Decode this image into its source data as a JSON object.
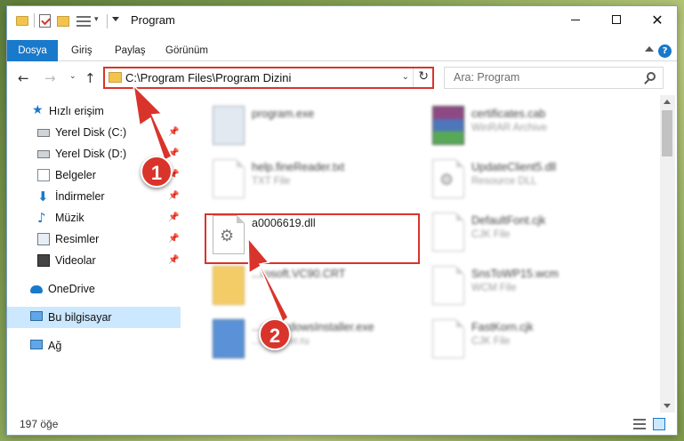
{
  "window": {
    "title": "Program",
    "minimize_glyph": "",
    "maximize_glyph": "",
    "close_glyph": "✕"
  },
  "ribbon": {
    "tabs": [
      "Dosya",
      "Giriş",
      "Paylaş",
      "Görünüm"
    ],
    "help": "?"
  },
  "navigation": {
    "back": "←",
    "forward": "→",
    "recent": "⌄",
    "up": "↑",
    "address": "C:\\Program Files\\Program Dizini",
    "address_dropdown": "⌄",
    "refresh": "↻",
    "search_placeholder": "Ara: Program"
  },
  "sidebar": {
    "items": [
      {
        "label": "Hızlı erişim",
        "icon": "star-icon",
        "pinned": false
      },
      {
        "label": "Yerel Disk (C:)",
        "icon": "drive-icon",
        "pinned": true
      },
      {
        "label": "Yerel Disk (D:)",
        "icon": "drive-icon",
        "pinned": true
      },
      {
        "label": "Belgeler",
        "icon": "documents-icon",
        "pinned": true
      },
      {
        "label": "İndirmeler",
        "icon": "download-icon",
        "pinned": true
      },
      {
        "label": "Müzik",
        "icon": "music-icon",
        "pinned": true
      },
      {
        "label": "Resimler",
        "icon": "pictures-icon",
        "pinned": true
      },
      {
        "label": "Videolar",
        "icon": "video-icon",
        "pinned": true
      },
      {
        "label": "OneDrive",
        "icon": "cloud-icon",
        "pinned": false
      },
      {
        "label": "Bu bilgisayar",
        "icon": "computer-icon",
        "pinned": false,
        "selected": true
      },
      {
        "label": "Ağ",
        "icon": "network-icon",
        "pinned": false
      }
    ],
    "pin_glyph": "📌"
  },
  "files": [
    {
      "name": "program.exe",
      "type": "",
      "icon": "exe-icon"
    },
    {
      "name": "certificates.cab",
      "type": "WinRAR Archive",
      "icon": "archive-icon"
    },
    {
      "name": "help.fineReader.txt",
      "type": "TXT File",
      "icon": "text-file-icon"
    },
    {
      "name": "UpdateClient5.dll",
      "type": "Resource DLL",
      "icon": "dll-icon"
    },
    {
      "name": "a0006619.dll",
      "type": "",
      "icon": "dll-icon",
      "highlighted": true
    },
    {
      "name": "DefaultFont.cjk",
      "type": "CJK File",
      "icon": "file-icon"
    },
    {
      "name": "...rosoft.VC90.CRT",
      "type": "",
      "icon": "folder-icon"
    },
    {
      "name": "SnsToWP15.wcm",
      "type": "WCM File",
      "icon": "file-icon"
    },
    {
      "name": "...s.WindowsInstaller.exe",
      "type": "...inreader.ru",
      "icon": "installer-icon"
    },
    {
      "name": "FastKorn.cjk",
      "type": "CJK File",
      "icon": "file-icon"
    }
  ],
  "status": {
    "item_count": "197 öğe"
  },
  "annotations": {
    "step1": "1",
    "step2": "2"
  },
  "colors": {
    "accent": "#1979ca",
    "highlight": "#d9342b",
    "selection": "#cce8ff"
  }
}
